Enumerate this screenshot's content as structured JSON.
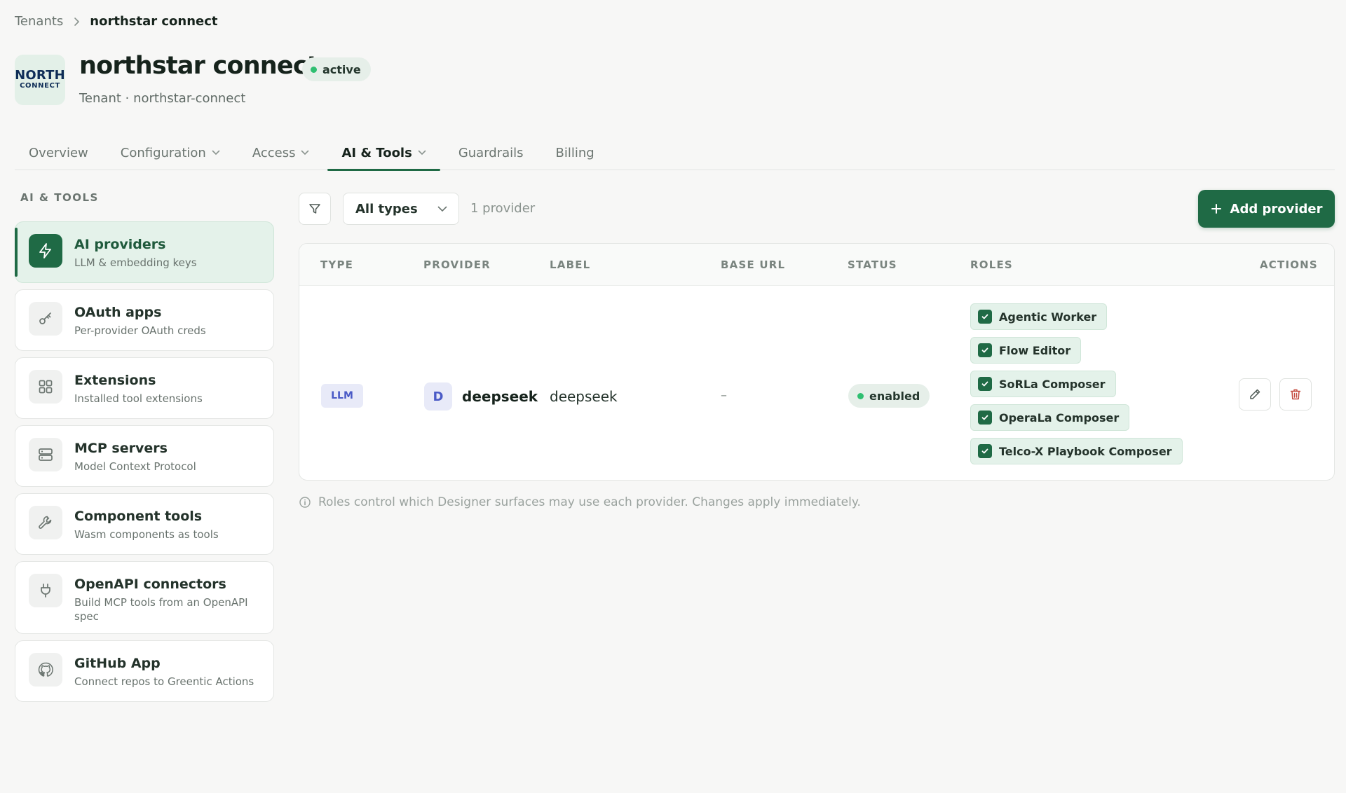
{
  "breadcrumb": {
    "parent": "Tenants",
    "current": "northstar connect"
  },
  "header": {
    "logo_line1": "NORTH",
    "logo_line2": "CONNECT",
    "title": "northstar connect",
    "status": "active",
    "subtitle": "Tenant · northstar-connect"
  },
  "tabs": [
    {
      "label": "Overview"
    },
    {
      "label": "Configuration"
    },
    {
      "label": "Access"
    },
    {
      "label": "AI & Tools"
    },
    {
      "label": "Guardrails"
    },
    {
      "label": "Billing"
    }
  ],
  "active_tab": "AI & Tools",
  "sidebar": {
    "heading": "AI & TOOLS",
    "items": [
      {
        "title": "AI providers",
        "desc": "LLM & embedding keys",
        "icon": "lightning-icon"
      },
      {
        "title": "OAuth apps",
        "desc": "Per-provider OAuth creds",
        "icon": "key-icon"
      },
      {
        "title": "Extensions",
        "desc": "Installed tool extensions",
        "icon": "grid-icon"
      },
      {
        "title": "MCP servers",
        "desc": "Model Context Protocol",
        "icon": "server-icon"
      },
      {
        "title": "Component tools",
        "desc": "Wasm components as tools",
        "icon": "wrench-icon"
      },
      {
        "title": "OpenAPI connectors",
        "desc": "Build MCP tools from an OpenAPI spec",
        "icon": "plug-icon"
      },
      {
        "title": "GitHub App",
        "desc": "Connect repos to Greentic Actions",
        "icon": "github-icon"
      }
    ]
  },
  "toolbar": {
    "type_filter": "All types",
    "count": "1 provider",
    "add_label": "Add provider"
  },
  "table": {
    "columns": {
      "type": "TYPE",
      "provider": "PROVIDER",
      "label": "LABEL",
      "base_url": "BASE URL",
      "status": "STATUS",
      "roles": "ROLES",
      "actions": "ACTIONS"
    },
    "rows": [
      {
        "type": "LLM",
        "avatar": "D",
        "provider": "deepseek",
        "label": "deepseek",
        "base_url": "–",
        "status": "enabled",
        "roles": [
          "Agentic Worker",
          "Flow Editor",
          "SoRLa Composer",
          "OperaLa Composer",
          "Telco-X Playbook Composer"
        ]
      }
    ]
  },
  "footnote": "Roles control which Designer surfaces may use each provider. Changes apply immediately.",
  "colors": {
    "accent": "#1f6a45",
    "accent_light": "#e4f2ea",
    "status_dot": "#2fbf71",
    "llm_badge": "#4a5ac6",
    "delete": "#c44a3e"
  }
}
